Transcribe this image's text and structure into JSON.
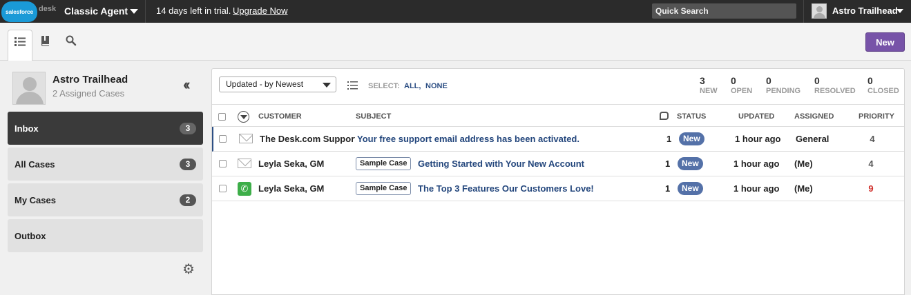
{
  "topbar": {
    "logo_brand": "salesforce",
    "logo_product": "desk",
    "agent_mode": "Classic Agent",
    "trial_text": "14 days left in trial.",
    "upgrade_label": "Upgrade Now",
    "search_placeholder": "Quick Search",
    "user_name": "Astro Trailhead"
  },
  "toolbar": {
    "tabs": [
      "list-icon",
      "book-icon",
      "search-icon"
    ],
    "new_label": "New"
  },
  "sidebar": {
    "user_name": "Astro Trailhead",
    "assigned_text": "2 Assigned Cases",
    "filters": [
      {
        "label": "Inbox",
        "count": "3",
        "active": true
      },
      {
        "label": "All Cases",
        "count": "3"
      },
      {
        "label": "My Cases",
        "count": "2"
      },
      {
        "label": "Outbox",
        "count": ""
      }
    ]
  },
  "main": {
    "sort_value": "Updated - by Newest",
    "select_label": "SELECT:",
    "select_all": "ALL,",
    "select_none": "NONE",
    "stats": [
      {
        "num": "3",
        "label": "NEW"
      },
      {
        "num": "0",
        "label": "OPEN"
      },
      {
        "num": "0",
        "label": "PENDING"
      },
      {
        "num": "0",
        "label": "RESOLVED"
      },
      {
        "num": "0",
        "label": "CLOSED"
      }
    ],
    "columns": {
      "customer": "CUSTOMER",
      "subject": "SUBJECT",
      "status": "STATUS",
      "updated": "UPDATED",
      "assigned": "ASSIGNED",
      "priority": "PRIORITY"
    },
    "rows": [
      {
        "channel": "email-icon",
        "customer": "The Desk.com Support",
        "tag": "",
        "subject": "Your free support email address has been activated.",
        "count": "1",
        "status": "New",
        "updated": "1 hour ago",
        "assigned": "General",
        "priority": "4",
        "priority_color": "#555555"
      },
      {
        "channel": "email-icon",
        "customer": "Leyla Seka, GM",
        "tag": "Sample Case",
        "subject": "Getting Started with Your New Account",
        "count": "1",
        "status": "New",
        "updated": "1 hour ago",
        "assigned": "(Me)",
        "priority": "4",
        "priority_color": "#555555"
      },
      {
        "channel": "phone-icon",
        "customer": "Leyla Seka, GM",
        "tag": "Sample Case",
        "subject": "The Top 3 Features Our Customers Love!",
        "count": "1",
        "status": "New",
        "updated": "1 hour ago",
        "assigned": "(Me)",
        "priority": "9",
        "priority_color": "#d0312d"
      }
    ]
  }
}
